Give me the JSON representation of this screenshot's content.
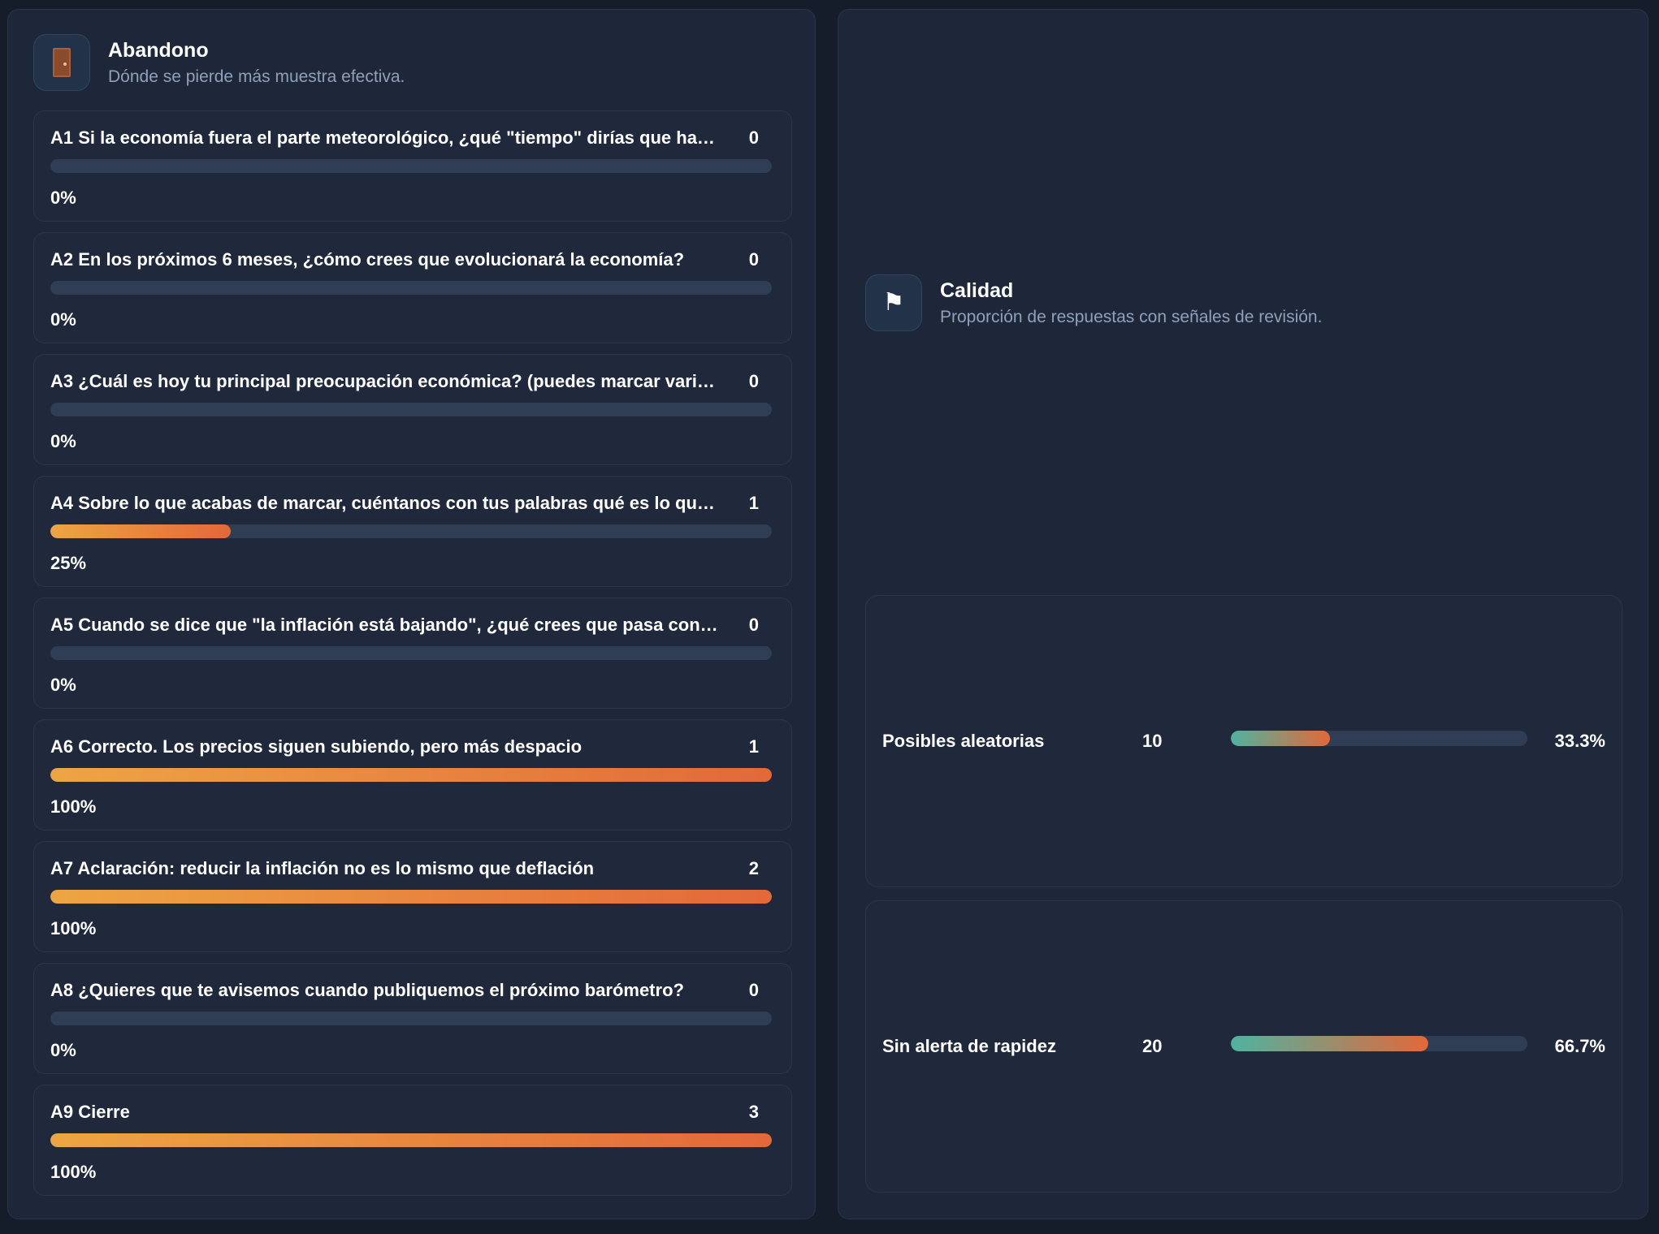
{
  "abandono": {
    "title": "Abandono",
    "subtitle": "Dónde se pierde más muestra efectiva.",
    "icon": "door-icon",
    "items": [
      {
        "label": "A1 Si la economía fuera el parte meteorológico, ¿qué \"tiempo\" dirías que ha…",
        "count": "0",
        "percent": "0%",
        "fill": 0
      },
      {
        "label": "A2 En los próximos 6 meses, ¿cómo crees que evolucionará la economía?",
        "count": "0",
        "percent": "0%",
        "fill": 0
      },
      {
        "label": "A3 ¿Cuál es hoy tu principal preocupación económica? (puedes marcar vari…",
        "count": "0",
        "percent": "0%",
        "fill": 0
      },
      {
        "label": "A4 Sobre lo que acabas de marcar, cuéntanos con tus palabras qué es lo qu…",
        "count": "1",
        "percent": "25%",
        "fill": 25
      },
      {
        "label": "A5 Cuando se dice que \"la inflación está bajando\", ¿qué crees que pasa con…",
        "count": "0",
        "percent": "0%",
        "fill": 0
      },
      {
        "label": "A6 Correcto. Los precios siguen subiendo, pero más despacio",
        "count": "1",
        "percent": "100%",
        "fill": 100
      },
      {
        "label": "A7 Aclaración: reducir la inflación no es lo mismo que deflación",
        "count": "2",
        "percent": "100%",
        "fill": 100
      },
      {
        "label": "A8 ¿Quieres que te avisemos cuando publiquemos el próximo barómetro?",
        "count": "0",
        "percent": "0%",
        "fill": 0
      },
      {
        "label": "A9 Cierre",
        "count": "3",
        "percent": "100%",
        "fill": 100
      }
    ]
  },
  "calidad": {
    "title": "Calidad",
    "subtitle": "Proporción de respuestas con señales de revisión.",
    "icon": "flag-icon",
    "rows": [
      {
        "label": "Posibles aleatorias",
        "count": "10",
        "percent": "33.3%",
        "fill": 33.3
      },
      {
        "label": "Sin alerta de rapidez",
        "count": "20",
        "percent": "66.7%",
        "fill": 66.7
      }
    ]
  },
  "colors": {
    "background": "#151c2a",
    "panel": "#1e2739",
    "track": "#2f3d55",
    "accent_start": "#eda543",
    "accent_end": "#e3683a",
    "quality_start": "#4fb3a0"
  }
}
